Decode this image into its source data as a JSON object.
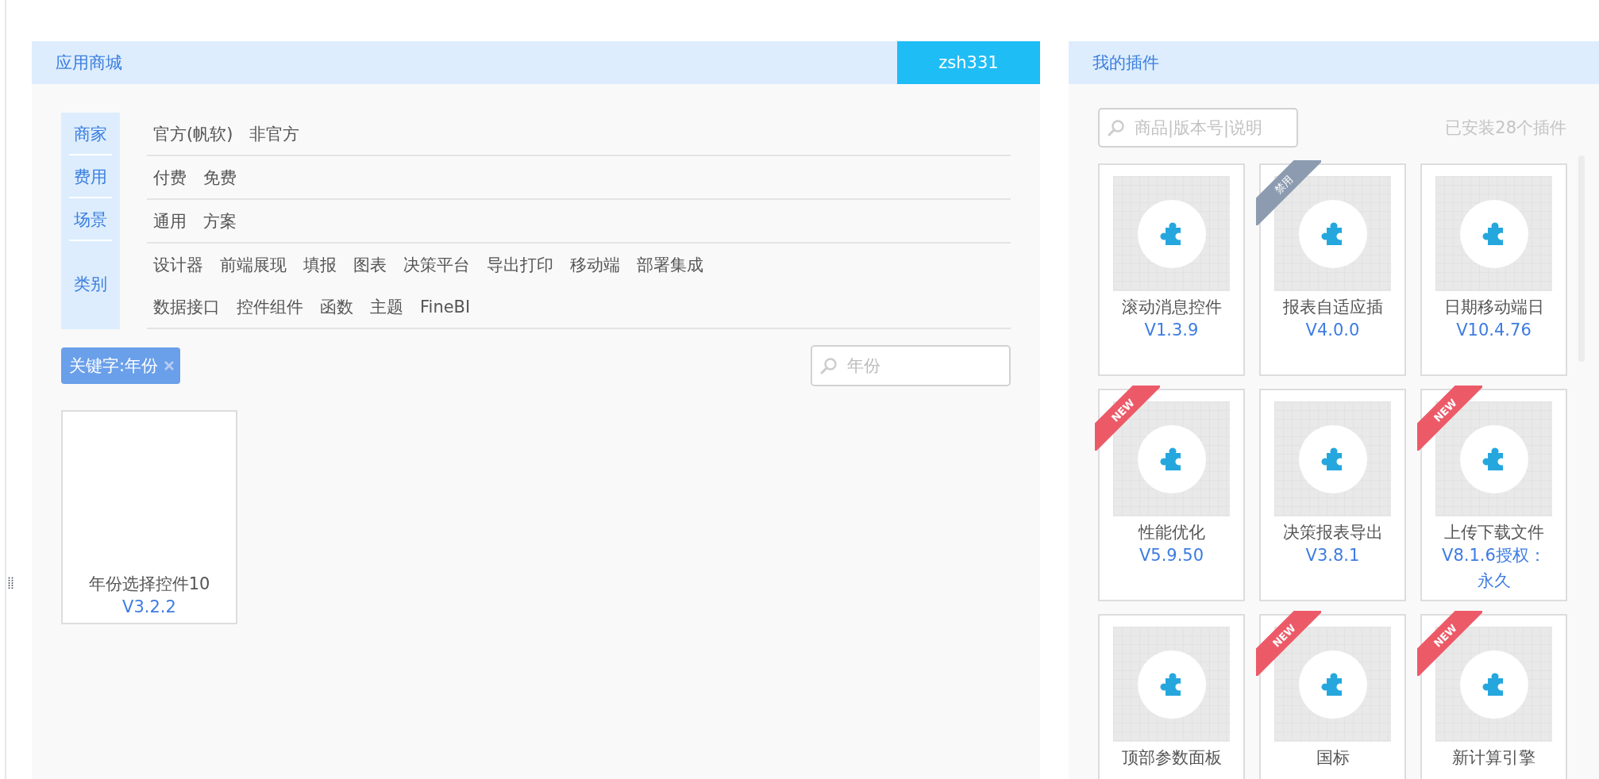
{
  "store": {
    "title": "应用商城",
    "user": "zsh331",
    "filters": [
      {
        "label": "商家",
        "lines": [
          [
            "官方(帆软)",
            "非官方"
          ]
        ]
      },
      {
        "label": "费用",
        "lines": [
          [
            "付费",
            "免费"
          ]
        ]
      },
      {
        "label": "场景",
        "lines": [
          [
            "通用",
            "方案"
          ]
        ]
      },
      {
        "label": "类别",
        "lines": [
          [
            "设计器",
            "前端展现",
            "填报",
            "图表",
            "决策平台",
            "导出打印",
            "移动端",
            "部署集成"
          ],
          [
            "数据接口",
            "控件组件",
            "函数",
            "主题",
            "FineBI"
          ]
        ]
      }
    ],
    "keyword_tag": {
      "label": "关键字:年份"
    },
    "search": {
      "value": "年份"
    },
    "results": [
      {
        "name": "年份选择控件10",
        "version": "V3.2.2"
      }
    ]
  },
  "my_plugins": {
    "title": "我的插件",
    "search": {
      "placeholder": "商品|版本号|说明"
    },
    "count": "已安装28个插件",
    "plugins": [
      {
        "name": "滚动消息控件",
        "version": "V1.3.9"
      },
      {
        "name": "报表自适应插",
        "version": "V4.0.0",
        "ribbon": {
          "kind": "disabled",
          "label": "禁用"
        }
      },
      {
        "name": "日期移动端日",
        "version": "V10.4.76"
      },
      {
        "name": "性能优化",
        "version": "V5.9.50",
        "ribbon": {
          "kind": "new",
          "label": "NEW"
        }
      },
      {
        "name": "决策报表导出",
        "version": "V3.8.1"
      },
      {
        "name": "上传下载文件",
        "version": "V8.1.6授权：永久",
        "ribbon": {
          "kind": "new",
          "label": "NEW"
        }
      },
      {
        "name": "顶部参数面板"
      },
      {
        "name": "国标",
        "ribbon": {
          "kind": "new",
          "label": "NEW"
        }
      },
      {
        "name": "新计算引擎",
        "ribbon": {
          "kind": "new",
          "label": "NEW"
        }
      }
    ]
  }
}
